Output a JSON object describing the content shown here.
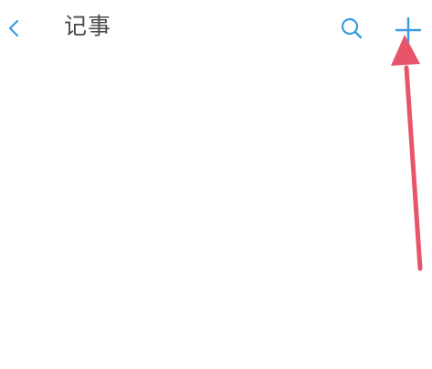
{
  "header": {
    "title": "记事"
  },
  "colors": {
    "accent": "#3a9be0",
    "title_text": "#4a4a4a",
    "arrow": "#e8556a",
    "background": "#ffffff"
  },
  "icons": {
    "back": "chevron-left-icon",
    "search": "search-icon",
    "add": "plus-icon",
    "annotation": "arrow-up-icon"
  }
}
